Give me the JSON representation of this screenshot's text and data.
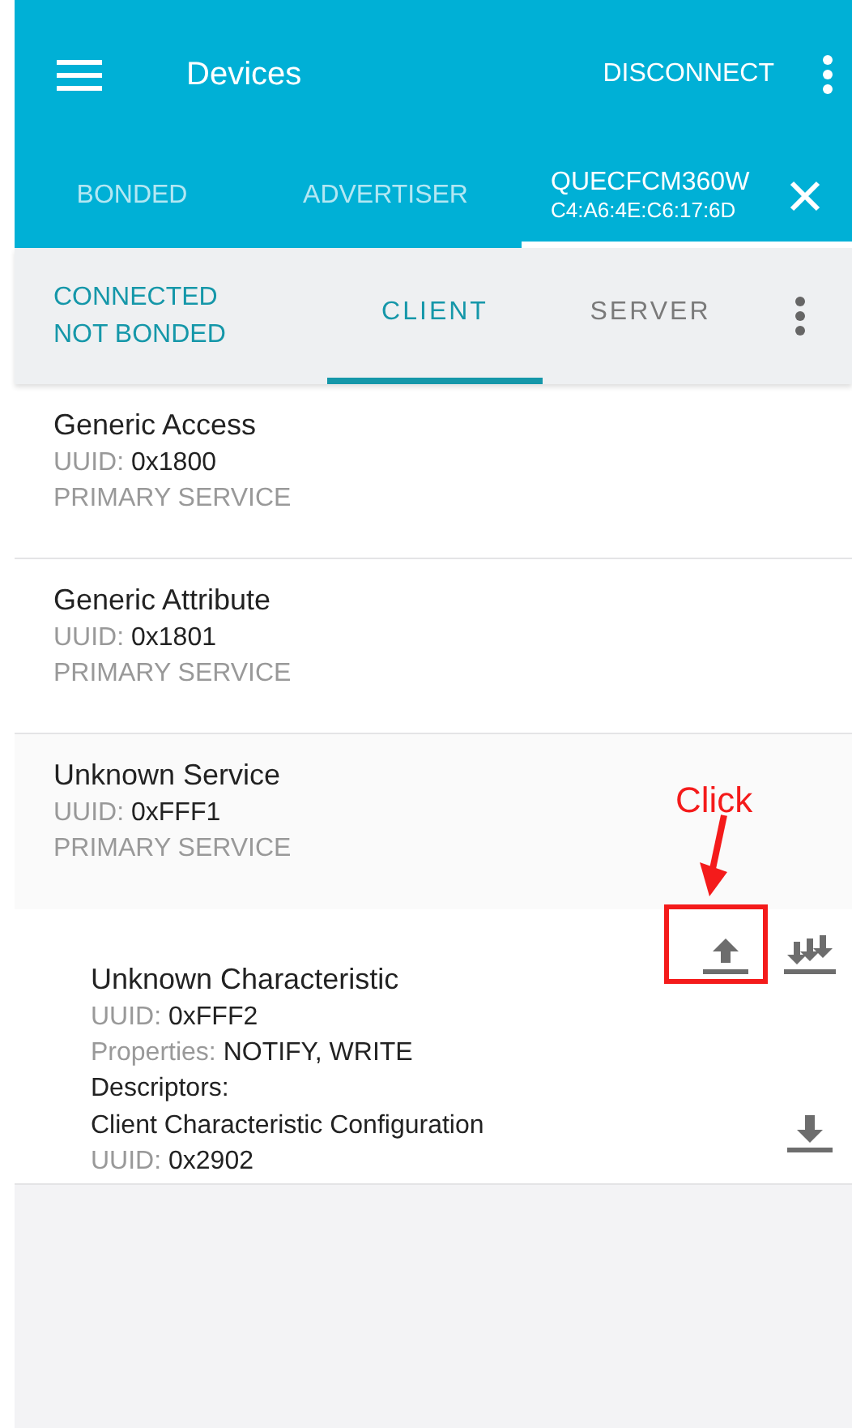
{
  "app_bar": {
    "title": "Devices",
    "action": "DISCONNECT"
  },
  "device_tabs": [
    {
      "label": "BONDED",
      "selected": false
    },
    {
      "label": "ADVERTISER",
      "selected": false
    },
    {
      "label": "QUECFCM360W",
      "subtitle": "C4:A6:4E:C6:17:6D",
      "selected": true
    }
  ],
  "connection_status": [
    "CONNECTED",
    "NOT BONDED"
  ],
  "role_tabs": [
    {
      "label": "CLIENT",
      "selected": true
    },
    {
      "label": "SERVER",
      "selected": false
    }
  ],
  "services": [
    {
      "name": "Generic Access",
      "uuid_label": "UUID:",
      "uuid": "0x1800",
      "type": "PRIMARY SERVICE",
      "expanded": false
    },
    {
      "name": "Generic Attribute",
      "uuid_label": "UUID:",
      "uuid": "0x1801",
      "type": "PRIMARY SERVICE",
      "expanded": false
    },
    {
      "name": "Unknown Service",
      "uuid_label": "UUID:",
      "uuid": "0xFFF1",
      "type": "PRIMARY SERVICE",
      "expanded": true,
      "characteristics": [
        {
          "name": "Unknown Characteristic",
          "uuid_label": "UUID:",
          "uuid": "0xFFF2",
          "properties_label": "Properties:",
          "properties": "NOTIFY, WRITE",
          "descriptors_label": "Descriptors:",
          "descriptors": [
            {
              "name": "Client Characteristic Configuration",
              "uuid_label": "UUID:",
              "uuid": "0x2902"
            }
          ]
        }
      ]
    }
  ],
  "annotation": {
    "label": "Click"
  }
}
